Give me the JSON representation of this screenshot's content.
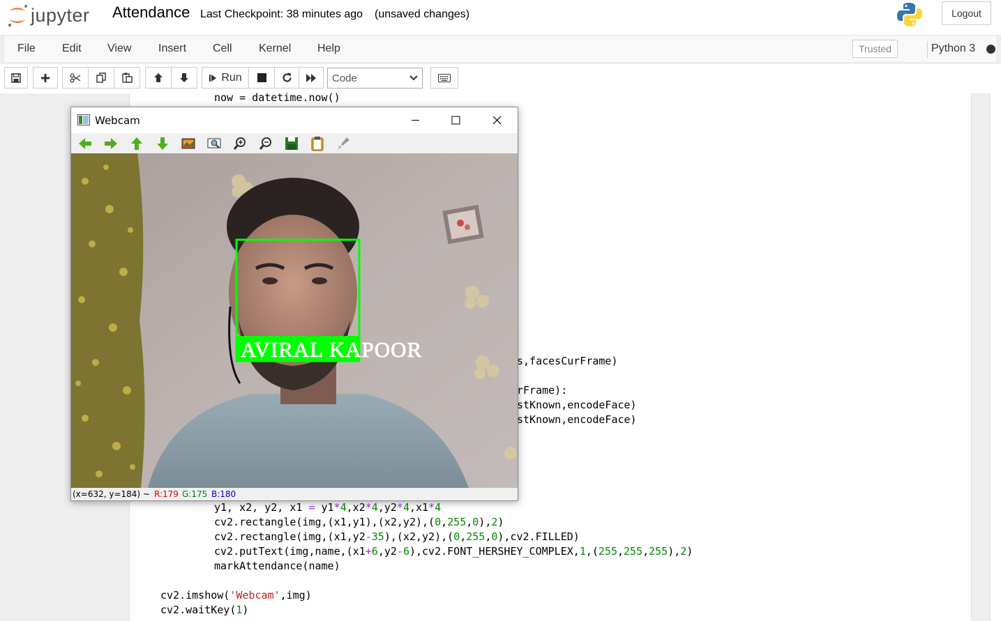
{
  "header": {
    "logo_text": "jupyter",
    "notebook_name": "Attendance",
    "checkpoint": "Last Checkpoint: 38 minutes ago",
    "unsaved": "(unsaved changes)",
    "logout_label": "Logout"
  },
  "menu": {
    "items": [
      "File",
      "Edit",
      "View",
      "Insert",
      "Cell",
      "Kernel",
      "Help"
    ],
    "trusted_label": "Trusted",
    "kernel_name": "Python 3"
  },
  "toolbar": {
    "run_label": "Run",
    "cell_type": "Code"
  },
  "webcam": {
    "title": "Webcam",
    "label": "AVIRAL KAPOOR",
    "status_coords": "(x=632, y=184) ~",
    "status_r": "R:179",
    "status_g": "G:175",
    "status_b": "B:180"
  },
  "code": {
    "line_now": "now = datetime.now()",
    "frag1": "s,facesCurFrame)",
    "frag2": "rFrame):",
    "frag3": "stKnown,encodeFace)",
    "frag4": "stKnown,encodeFace)"
  },
  "colors": {
    "face_box": "#00ff00",
    "label_text": "#ffffff",
    "accent_orange": "#f37726",
    "status_red": "#d40000",
    "status_green": "#008000",
    "status_blue": "#0000d4"
  }
}
